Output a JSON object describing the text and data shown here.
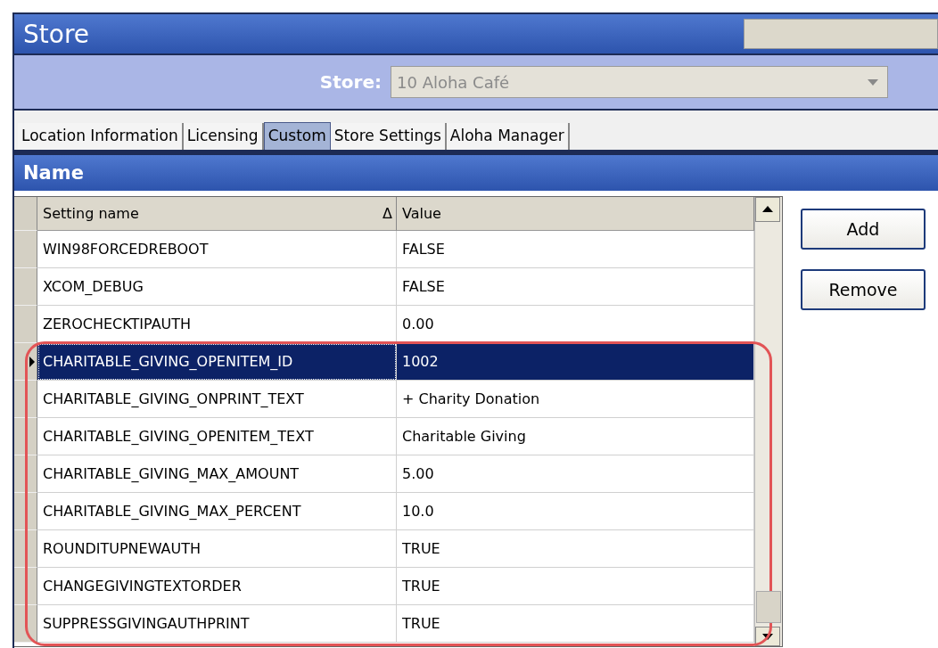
{
  "window": {
    "title": "Store"
  },
  "store_selector": {
    "label": "Store:",
    "value": "10 Aloha Café"
  },
  "tabs": [
    {
      "label": "Location Information",
      "selected": false
    },
    {
      "label": "Licensing",
      "selected": false
    },
    {
      "label": "Custom",
      "selected": true
    },
    {
      "label": "Store Settings",
      "selected": false
    },
    {
      "label": "Aloha Manager",
      "selected": false
    }
  ],
  "section": {
    "title": "Name"
  },
  "table": {
    "columns": [
      {
        "label": "Setting name",
        "sort_icon": "Δ"
      },
      {
        "label": "Value"
      }
    ],
    "rows": [
      {
        "name": "WIN98FORCEDREBOOT",
        "value": "FALSE",
        "selected": false
      },
      {
        "name": "XCOM_DEBUG",
        "value": "FALSE",
        "selected": false
      },
      {
        "name": "ZEROCHECKTIPAUTH",
        "value": "0.00",
        "selected": false
      }
    ],
    "highlighted_rows": [
      {
        "name": "CHARITABLE_GIVING_OPENITEM_ID",
        "value": "1002",
        "selected": true
      },
      {
        "name": "CHARITABLE_GIVING_ONPRINT_TEXT",
        "value": "+ Charity Donation",
        "selected": false
      },
      {
        "name": "CHARITABLE_GIVING_OPENITEM_TEXT",
        "value": "Charitable Giving",
        "selected": false
      },
      {
        "name": "CHARITABLE_GIVING_MAX_AMOUNT",
        "value": "5.00",
        "selected": false
      },
      {
        "name": "CHARITABLE_GIVING_MAX_PERCENT",
        "value": "10.0",
        "selected": false
      },
      {
        "name": "ROUNDITUPNEWAUTH",
        "value": "TRUE",
        "selected": false
      },
      {
        "name": "CHANGEGIVINGTEXTORDER",
        "value": "TRUE",
        "selected": false
      },
      {
        "name": "SUPPRESSGIVINGAUTHPRINT",
        "value": "TRUE",
        "selected": false
      }
    ]
  },
  "buttons": [
    {
      "label": "Add"
    },
    {
      "label": "Remove"
    }
  ]
}
